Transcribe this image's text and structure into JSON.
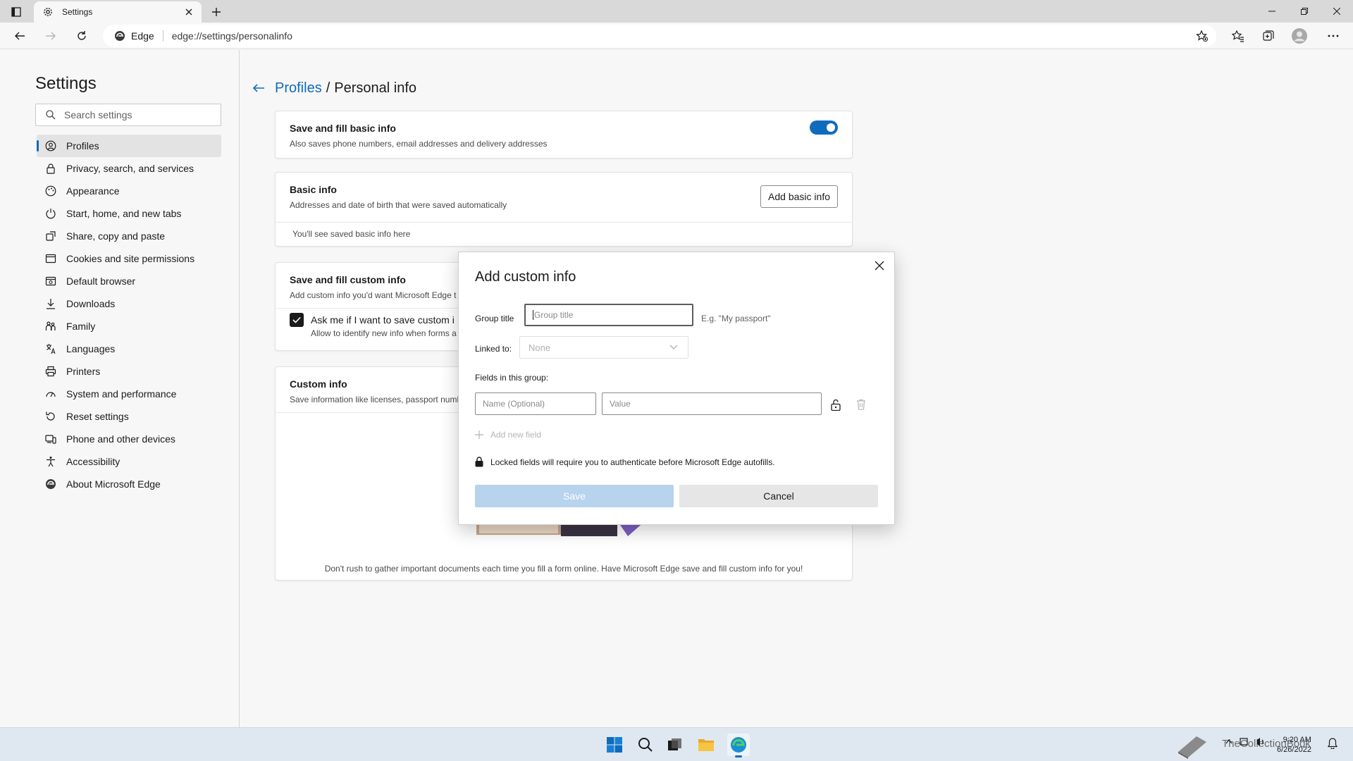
{
  "browser": {
    "tab_title": "Settings",
    "site_name": "Edge",
    "url": "edge://settings/personalinfo"
  },
  "sidebar": {
    "title": "Settings",
    "search_placeholder": "Search settings",
    "items": [
      {
        "label": "Profiles",
        "icon": "profile-icon",
        "active": true
      },
      {
        "label": "Privacy, search, and services",
        "icon": "lock-icon"
      },
      {
        "label": "Appearance",
        "icon": "appearance-icon"
      },
      {
        "label": "Start, home, and new tabs",
        "icon": "power-icon"
      },
      {
        "label": "Share, copy and paste",
        "icon": "share-icon"
      },
      {
        "label": "Cookies and site permissions",
        "icon": "cookie-icon"
      },
      {
        "label": "Default browser",
        "icon": "browser-icon"
      },
      {
        "label": "Downloads",
        "icon": "download-icon"
      },
      {
        "label": "Family",
        "icon": "family-icon"
      },
      {
        "label": "Languages",
        "icon": "language-icon"
      },
      {
        "label": "Printers",
        "icon": "printer-icon"
      },
      {
        "label": "System and performance",
        "icon": "system-icon"
      },
      {
        "label": "Reset settings",
        "icon": "reset-icon"
      },
      {
        "label": "Phone and other devices",
        "icon": "phone-icon"
      },
      {
        "label": "Accessibility",
        "icon": "accessibility-icon"
      },
      {
        "label": "About Microsoft Edge",
        "icon": "edge-icon"
      }
    ]
  },
  "breadcrumb": {
    "parent": "Profiles",
    "separator": "/",
    "current": "Personal info"
  },
  "cards": {
    "basic_fill": {
      "title": "Save and fill basic info",
      "subtitle": "Also saves phone numbers, email addresses and delivery addresses",
      "toggle_on": true
    },
    "basic_info": {
      "title": "Basic info",
      "subtitle": "Addresses and date of birth that were saved automatically",
      "button": "Add basic info",
      "empty_text": "You'll see saved basic info here"
    },
    "custom_fill": {
      "title": "Save and fill custom info",
      "subtitle": "Add custom info you'd want Microsoft Edge t",
      "checkbox_label": "Ask me if I want to save custom i",
      "checkbox_sub": "Allow to identify new info when forms a",
      "checked": true
    },
    "custom_info": {
      "title": "Custom info",
      "subtitle": "Save information like licenses, passport numb",
      "footer": "Don't rush to gather important documents each time you fill a form online. Have Microsoft Edge save and fill custom info for you!"
    }
  },
  "dialog": {
    "title": "Add custom info",
    "group_title_label": "Group title",
    "group_title_placeholder": "Group title",
    "group_title_hint": "E.g. \"My passport\"",
    "linked_label": "Linked to:",
    "linked_value": "None",
    "fields_label": "Fields in this group:",
    "name_placeholder": "Name (Optional)",
    "value_placeholder": "Value",
    "add_field": "Add new field",
    "lock_note": "Locked fields will require you to authenticate before Microsoft Edge autofills.",
    "save": "Save",
    "cancel": "Cancel"
  },
  "taskbar": {
    "time": "9:20 AM",
    "date": "6/26/2022",
    "watermark": "TheCollectionBook"
  },
  "colors": {
    "accent": "#0f6cbd",
    "save_disabled_bg": "#b7d3ee",
    "cancel_bg": "#e6e6e6"
  }
}
